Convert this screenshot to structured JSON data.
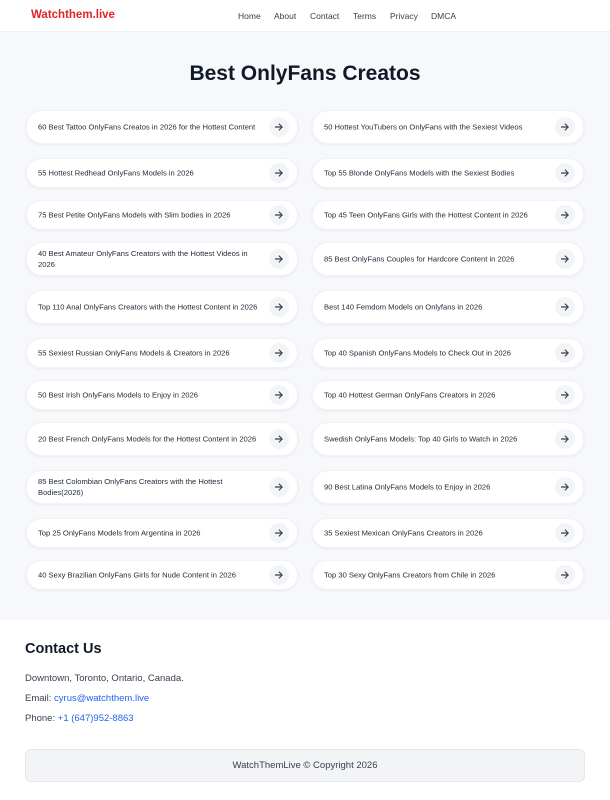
{
  "header": {
    "logo": "Watchthem.live",
    "nav": [
      {
        "label": "Home"
      },
      {
        "label": "About"
      },
      {
        "label": "Contact"
      },
      {
        "label": "Terms"
      },
      {
        "label": "Privacy"
      },
      {
        "label": "DMCA"
      }
    ]
  },
  "main": {
    "title": "Best OnlyFans Creatos",
    "articles_left": [
      {
        "label": "60 Best Tattoo OnlyFans Creatos in 2026 for the Hottest Content"
      },
      {
        "label": "55 Hottest Redhead OnlyFans Models in 2026"
      },
      {
        "label": "75 Best Petite OnlyFans Models with Slim bodies in 2026"
      },
      {
        "label": "40 Best Amateur OnlyFans Creators with the Hottest Videos in 2026"
      },
      {
        "label": "Top 110 Anal OnlyFans Creators with the Hottest Content in 2026"
      },
      {
        "label": "55 Sexiest Russian OnlyFans Models & Creators in 2026"
      },
      {
        "label": "50 Best Irish OnlyFans Models to Enjoy in 2026"
      },
      {
        "label": "20 Best French OnlyFans Models for the Hottest Content in 2026"
      },
      {
        "label": "85 Best Colombian OnlyFans Creators with the Hottest Bodies(2026)"
      },
      {
        "label": "Top 25 OnlyFans Models from Argentina in 2026"
      },
      {
        "label": "40 Sexy Brazilian OnlyFans Girls for Nude Content in 2026"
      }
    ],
    "articles_right": [
      {
        "label": "50 Hottest YouTubers on OnlyFans with the Sexiest Videos"
      },
      {
        "label": "Top 55 Blonde OnlyFans Models with the Sexiest Bodies"
      },
      {
        "label": "Top 45 Teen OnlyFans Girls with the Hottest Content in 2026"
      },
      {
        "label": "85 Best OnlyFans Couples for Hardcore Content in 2026"
      },
      {
        "label": "Best 140 Femdom Models on Onlyfans in 2026"
      },
      {
        "label": "Top 40 Spanish OnlyFans Models to Check Out in 2026"
      },
      {
        "label": "Top 40 Hottest German OnlyFans Creators in 2026"
      },
      {
        "label": "Swedish OnlyFans Models: Top 40 Girls to Watch in 2026"
      },
      {
        "label": "90 Best Latina OnlyFans Models to Enjoy in 2026"
      },
      {
        "label": "35 Sexiest Mexican OnlyFans Creators in 2026"
      },
      {
        "label": "Top 30 Sexy OnlyFans Creators from Chile in 2026"
      }
    ]
  },
  "contact": {
    "title": "Contact Us",
    "address": "Downtown, Toronto, Ontario, Canada.",
    "email_label": "Email:",
    "email": "cyrus@watchthem.live",
    "phone_label": "Phone:",
    "phone": "+1 (647)952-8863"
  },
  "footer": {
    "copyright": "WatchThemLive © Copyright 2026"
  },
  "colors": {
    "brand": "#e0242a",
    "link": "#2563eb",
    "background": "#f6f8fb"
  }
}
